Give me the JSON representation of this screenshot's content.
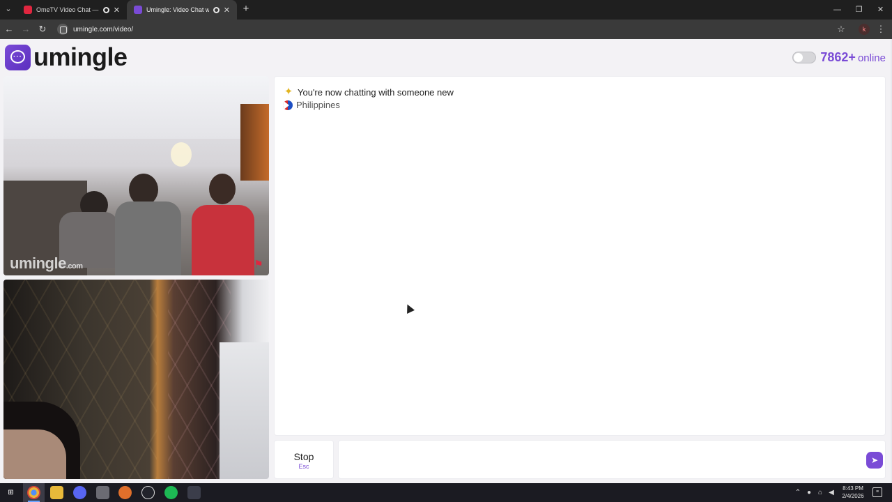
{
  "browser": {
    "tabs": [
      {
        "title": "OmeTV Video Chat — Ome",
        "active": false,
        "favicon_color": "#e0263f"
      },
      {
        "title": "Umingle: Video Chat with St",
        "active": true,
        "favicon_color": "#7a4bd6"
      }
    ],
    "new_tab_icon": "+",
    "url": "umingle.com/video/",
    "profile_initial": "k"
  },
  "site": {
    "brand": "umingle",
    "online_count": "7862+",
    "online_label": "online",
    "accent_color": "#7a4bd6"
  },
  "remote_video": {
    "watermark": "umingle",
    "watermark_suffix": ".com"
  },
  "chat": {
    "system_message": "You're now chatting with someone new",
    "country": "Philippines"
  },
  "controls": {
    "stop_label": "Stop",
    "stop_shortcut": "Esc",
    "message_placeholder": ""
  },
  "taskbar": {
    "time": "8:43 PM",
    "date": "2/4/2026"
  }
}
